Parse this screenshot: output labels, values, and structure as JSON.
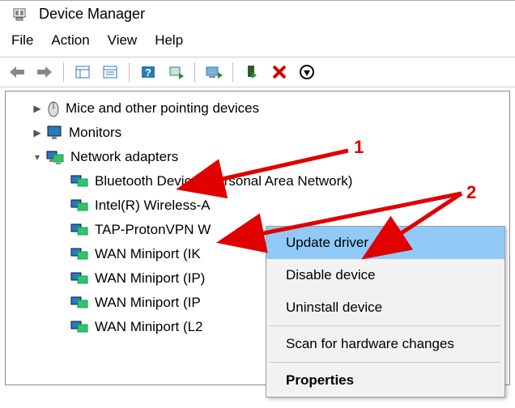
{
  "window": {
    "title": "Device Manager"
  },
  "menu": {
    "file": "File",
    "action": "Action",
    "view": "View",
    "help": "Help"
  },
  "tree": {
    "mice": "Mice and other pointing devices",
    "monitors": "Monitors",
    "network": "Network adapters",
    "network_children": {
      "bluetooth": "Bluetooth Device (Personal Area Network)",
      "intel": "Intel(R) Wireless-A",
      "tap": "TAP-ProtonVPN W",
      "wan_ike": "WAN Miniport (IK",
      "wan_ip": "WAN Miniport (IP)",
      "wan_ipv": "WAN Miniport (IP",
      "wan_l2": "WAN Miniport (L2"
    }
  },
  "context_menu": {
    "update": "Update driver",
    "disable": "Disable device",
    "uninstall": "Uninstall device",
    "scan": "Scan for hardware changes",
    "properties": "Properties"
  },
  "annotations": {
    "one": "1",
    "two": "2"
  }
}
